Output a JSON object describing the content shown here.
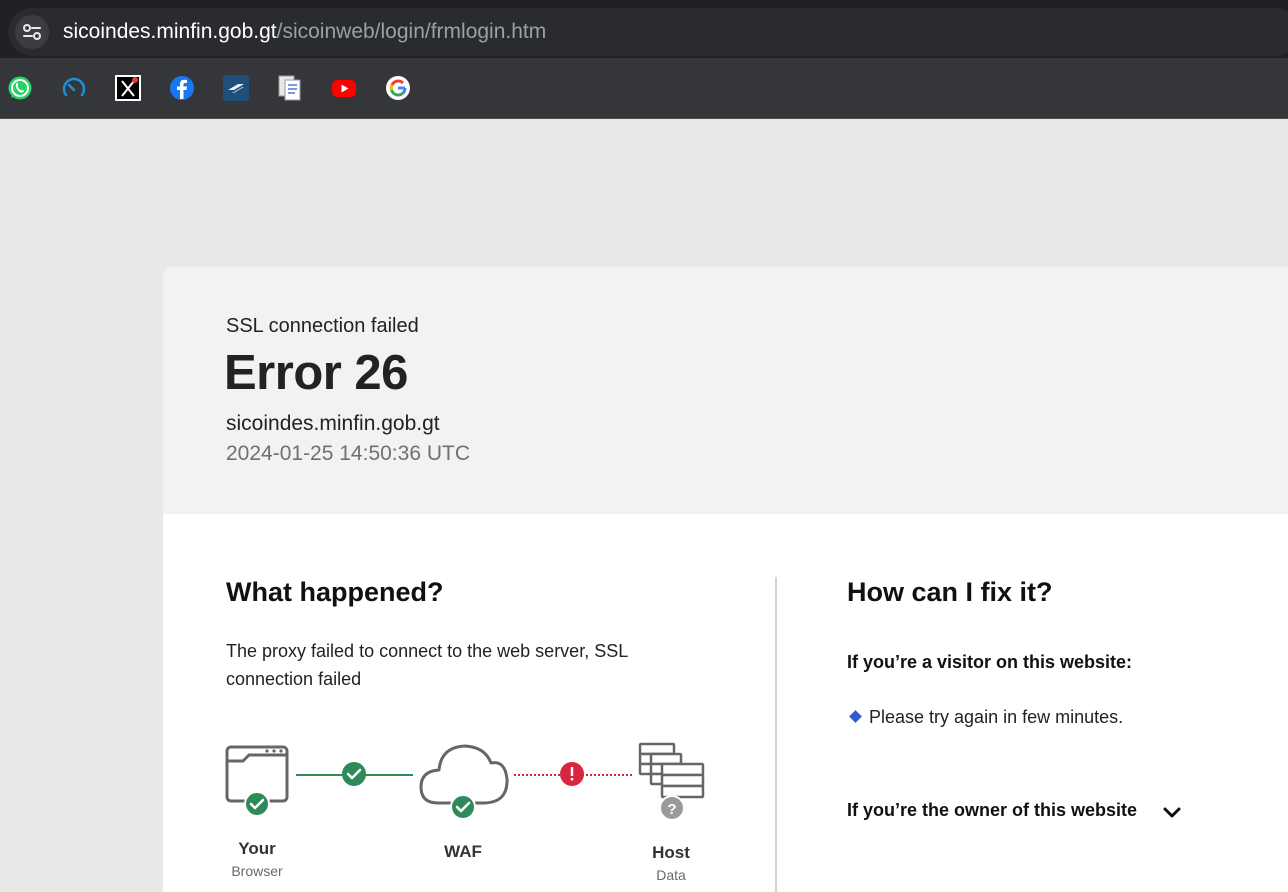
{
  "browser": {
    "url_host": "sicoindes.minfin.gob.gt",
    "url_path": "/sicoinweb/login/frmlogin.htm",
    "site_info_icon": "tune-icon",
    "bookmarks": [
      {
        "name": "whatsapp-icon"
      },
      {
        "name": "speedtest-icon"
      },
      {
        "name": "x-icon"
      },
      {
        "name": "facebook-icon"
      },
      {
        "name": "app-logo-icon"
      },
      {
        "name": "docs-icon"
      },
      {
        "name": "youtube-icon"
      },
      {
        "name": "google-icon"
      }
    ]
  },
  "error": {
    "subtitle": "SSL connection failed",
    "title": "Error 26",
    "domain": "sicoindes.minfin.gob.gt",
    "timestamp": "2024-01-25 14:50:36 UTC"
  },
  "what_happened": {
    "heading": "What happened?",
    "description": "The proxy failed to connect to the web server, SSL connection failed"
  },
  "diagram": {
    "browser_label": "Your",
    "browser_sub": "Browser",
    "waf_label": "WAF",
    "host_label": "Host",
    "host_sub": "Data",
    "colors": {
      "ok": "#2e8b57",
      "error": "#d7263d",
      "unknown": "#9a9a9a"
    }
  },
  "fix": {
    "heading": "How can I fix it?",
    "visitor_heading": "If you’re a visitor on this website:",
    "visitor_tip": "Please try again in few minutes.",
    "owner_heading": "If you’re the owner of this website"
  }
}
